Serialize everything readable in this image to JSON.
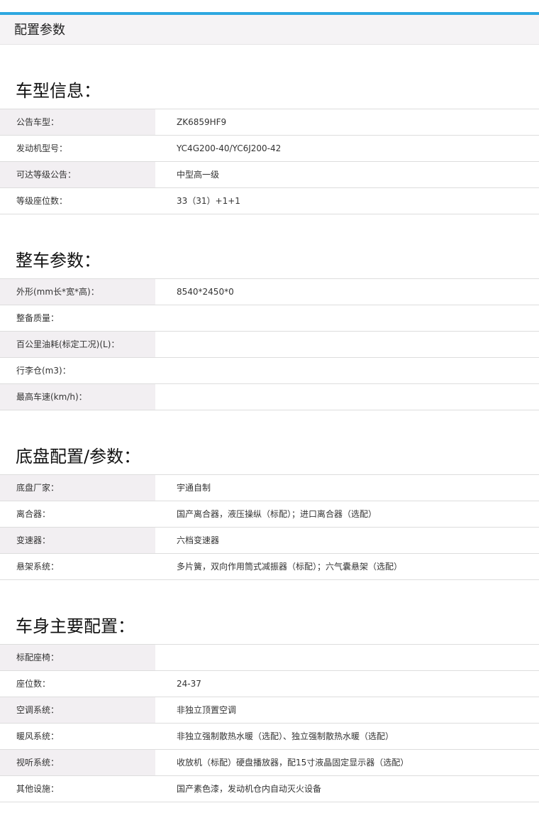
{
  "header": {
    "title": "配置参数"
  },
  "sections": [
    {
      "title": "车型信息：",
      "rows": [
        {
          "label": "公告车型：",
          "value": "ZK6859HF9"
        },
        {
          "label": "发动机型号：",
          "value": "YC4G200-40/YC6J200-42"
        },
        {
          "label": "可达等级公告：",
          "value": "中型高一级"
        },
        {
          "label": "等级座位数：",
          "value": "33（31）+1+1"
        }
      ]
    },
    {
      "title": "整车参数：",
      "rows": [
        {
          "label": "外形(mm长*宽*高)：",
          "value": "8540*2450*0"
        },
        {
          "label": "整备质量：",
          "value": ""
        },
        {
          "label": "百公里油耗(标定工况)(L)：",
          "value": ""
        },
        {
          "label": "行李仓(m3)：",
          "value": ""
        },
        {
          "label": "最高车速(km/h)：",
          "value": ""
        }
      ]
    },
    {
      "title": "底盘配置/参数：",
      "rows": [
        {
          "label": "底盘厂家：",
          "value": "宇通自制"
        },
        {
          "label": "离合器：",
          "value": "国产离合器，液压操纵（标配）；进口离合器（选配）"
        },
        {
          "label": "变速器：",
          "value": "六档变速器"
        },
        {
          "label": "悬架系统：",
          "value": "多片簧，双向作用筒式减振器（标配）；六气囊悬架（选配）"
        }
      ]
    },
    {
      "title": "车身主要配置：",
      "rows": [
        {
          "label": "标配座椅：",
          "value": ""
        },
        {
          "label": "座位数：",
          "value": "24-37"
        },
        {
          "label": "空调系统：",
          "value": "非独立顶置空调"
        },
        {
          "label": "暖风系统：",
          "value": "非独立强制散热水暖（选配）、独立强制散热水暖（选配）"
        },
        {
          "label": "视听系统：",
          "value": "收放机（标配）硬盘播放器，配15寸液晶固定显示器（选配）"
        },
        {
          "label": "其他设施：",
          "value": "国产素色漆，发动机仓内自动灭火设备"
        }
      ]
    }
  ]
}
